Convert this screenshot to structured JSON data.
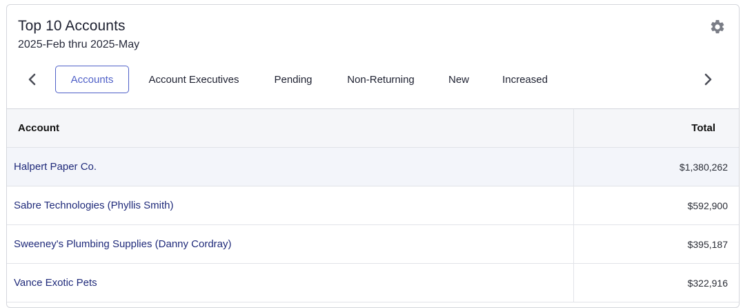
{
  "widget": {
    "title": "Top 10 Accounts",
    "subtitle": "2025-Feb thru 2025-May",
    "settings_icon": "gear-icon"
  },
  "tabs": [
    {
      "label": "Accounts",
      "active": true
    },
    {
      "label": "Account Executives",
      "active": false
    },
    {
      "label": "Pending",
      "active": false
    },
    {
      "label": "Non-Returning",
      "active": false
    },
    {
      "label": "New",
      "active": false
    },
    {
      "label": "Increased",
      "active": false
    }
  ],
  "table": {
    "columns": [
      "Account",
      "Total"
    ],
    "rows": [
      {
        "account": "Halpert Paper Co.",
        "total": "$1,380,262"
      },
      {
        "account": "Sabre Technologies (Phyllis Smith)",
        "total": "$592,900"
      },
      {
        "account": "Sweeney's Plumbing Supplies (Danny Cordray)",
        "total": "$395,187"
      },
      {
        "account": "Vance Exotic Pets",
        "total": "$322,916"
      }
    ]
  },
  "colors": {
    "accent": "#4e5fc7",
    "link": "#1f2a7a",
    "header_bg": "#f5f6f9",
    "border": "#d4d6dc"
  }
}
